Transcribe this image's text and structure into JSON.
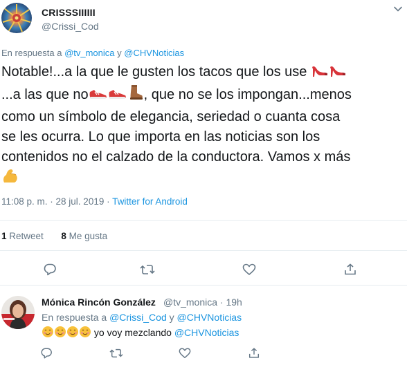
{
  "tweet": {
    "display_name": "CRISSSIIIIII",
    "handle": "@Crissi_Cod",
    "reply_prefix": "En respuesta a ",
    "reply_user1": "@tv_monica",
    "reply_joiner": " y ",
    "reply_user2": "@CHVNoticias",
    "text_line1": "Notable!...a la que le gusten los tacos que los use",
    "text_line2a": "...a las que no",
    "text_line2b": ", que no se los impongan...menos",
    "text_line3": "como un símbolo de elegancia, seriedad o cuanta cosa",
    "text_line4": "se les ocurra. Lo que importa en las noticias son los",
    "text_line5": "contenidos no el calzado de la conductora. Vamos x más",
    "emoji_line1": [
      "high-heel-icon",
      "high-heel-icon"
    ],
    "emoji_line2": [
      "sneaker-icon",
      "sneaker-icon",
      "boot-icon"
    ],
    "emoji_line6": [
      "flexed-biceps-icon"
    ],
    "time": "11:08 p. m. · 28 jul. 2019 · ",
    "client": "Twitter for Android",
    "retweet_count": "1",
    "retweet_label": " Retweet",
    "like_count": "8",
    "like_label": " Me gusta"
  },
  "reply": {
    "display_name": "Mónica Rincón González",
    "handle": "@tv_monica · 19h",
    "reply_prefix": "En respuesta a ",
    "reply_user1": "@Crissi_Cod",
    "reply_joiner": " y ",
    "reply_user2": "@CHVNoticias",
    "emojis": [
      "smiling-face-icon",
      "smiling-face-icon",
      "smiling-face-icon",
      "smiling-face-icon"
    ],
    "text_before": " yo voy mezclando ",
    "text_mention": "@CHVNoticias"
  },
  "colors": {
    "link": "#1b95e0",
    "muted": "#657786",
    "text": "#14171a",
    "separator": "#e6ecf0"
  }
}
